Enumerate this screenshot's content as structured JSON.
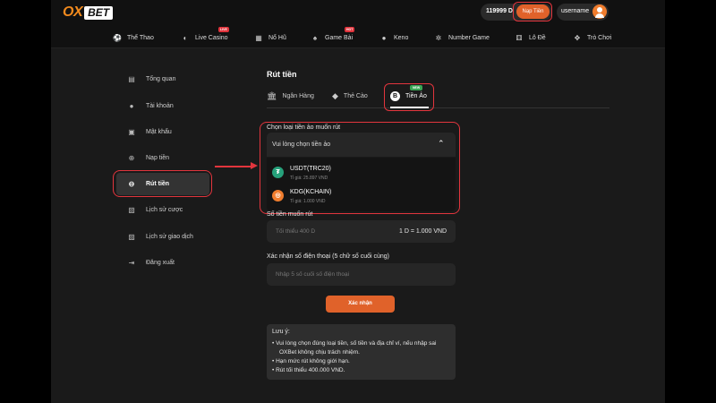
{
  "header": {
    "logo_ox": "OX",
    "logo_bet": "BET",
    "balance": "119999 D",
    "deposit_label": "Nạp Tiền",
    "username": "username"
  },
  "nav": [
    {
      "label": "Thể Thao",
      "icon": "soccer-ball-icon",
      "badge": ""
    },
    {
      "label": "Live Casino",
      "icon": "mask-icon",
      "badge": "LIVE"
    },
    {
      "label": "Nổ Hũ",
      "icon": "slot-icon",
      "badge": ""
    },
    {
      "label": "Game Bài",
      "icon": "spade-icon",
      "badge": "HOT"
    },
    {
      "label": "Keno",
      "icon": "keno-ball-icon",
      "badge": ""
    },
    {
      "label": "Number Game",
      "icon": "number-icon",
      "badge": ""
    },
    {
      "label": "Lô Đề",
      "icon": "dice-icon",
      "badge": ""
    },
    {
      "label": "Trò Chơi",
      "icon": "gamepad-icon",
      "badge": ""
    }
  ],
  "sidebar": [
    {
      "label": "Tổng quan",
      "icon": "overview-icon"
    },
    {
      "label": "Tài khoản",
      "icon": "user-icon"
    },
    {
      "label": "Mật khẩu",
      "icon": "lock-icon"
    },
    {
      "label": "Nạp tiền",
      "icon": "deposit-icon"
    },
    {
      "label": "Rút tiền",
      "icon": "withdraw-icon",
      "active": true
    },
    {
      "label": "Lịch sử cược",
      "icon": "bet-history-icon"
    },
    {
      "label": "Lịch sử giao dịch",
      "icon": "transaction-history-icon"
    },
    {
      "label": "Đăng xuất",
      "icon": "logout-icon"
    }
  ],
  "main": {
    "title": "Rút tiền",
    "tabs": [
      {
        "label": "Ngân Hàng",
        "icon": "bank-icon"
      },
      {
        "label": "Thẻ Cào",
        "icon": "card-icon"
      },
      {
        "label": "Tiền Ảo",
        "icon": "bitcoin-icon",
        "active": true,
        "badge": "NEW"
      }
    ],
    "crypto_label": "Chọn loại tiền ảo muốn rút",
    "select_placeholder": "Vui lòng chọn tiền ảo",
    "options": [
      {
        "name": "USDT(TRC20)",
        "rate": "Tỉ giá: 25.897 VND",
        "color": "#26a17b",
        "icon": "tether-icon"
      },
      {
        "name": "KDG(KCHAIN)",
        "rate": "Tỉ giá: 1.000 VND",
        "color": "#f07d2e",
        "icon": "kdg-icon"
      }
    ],
    "amount_label": "Số tiền muốn rút",
    "amount_placeholder": "Tối thiểu 400 D",
    "amount_rate": "1 D = 1.000 VND",
    "phone_label": "Xác nhận số điện thoại (5 chữ số cuối cùng)",
    "phone_placeholder": "Nhập 5 số cuối số điện thoại",
    "confirm_label": "Xác nhận",
    "note_title": "Lưu ý:",
    "notes": [
      "• Vui lòng chọn đúng loại tiền, số tiền và địa chỉ ví, nếu nhập sai",
      "OXBet không chịu trách nhiệm.",
      "• Hạn mức rút không giới hạn.",
      "• Rút tối thiểu 400.000 VND."
    ]
  },
  "colors": {
    "accent": "#e0622a",
    "highlight": "#e2353d",
    "brand": "#f28a1d"
  }
}
